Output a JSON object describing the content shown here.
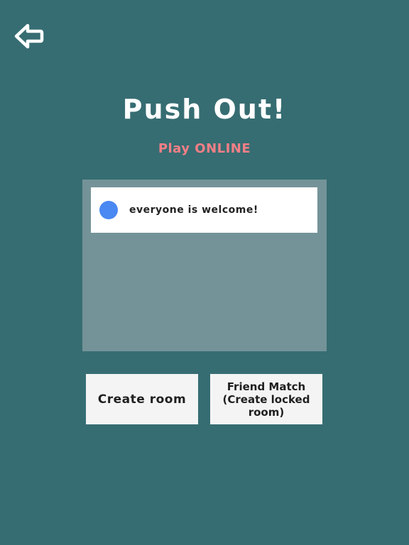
{
  "header": {
    "back_icon": "back-arrow-icon"
  },
  "title": "Push Out!",
  "subtitle": "Play ONLINE",
  "room_list": {
    "rooms": [
      {
        "name": "everyone is welcome!",
        "indicator_color": "#4a88f2"
      }
    ]
  },
  "buttons": {
    "create_room": "Create room",
    "friend_match": "Friend Match\n(Create locked\nroom)"
  },
  "colors": {
    "background": "#366d72",
    "title": "#ffffff",
    "subtitle": "#f27f86",
    "room_list_panel": "#749398",
    "button": "#f4f4f4"
  }
}
